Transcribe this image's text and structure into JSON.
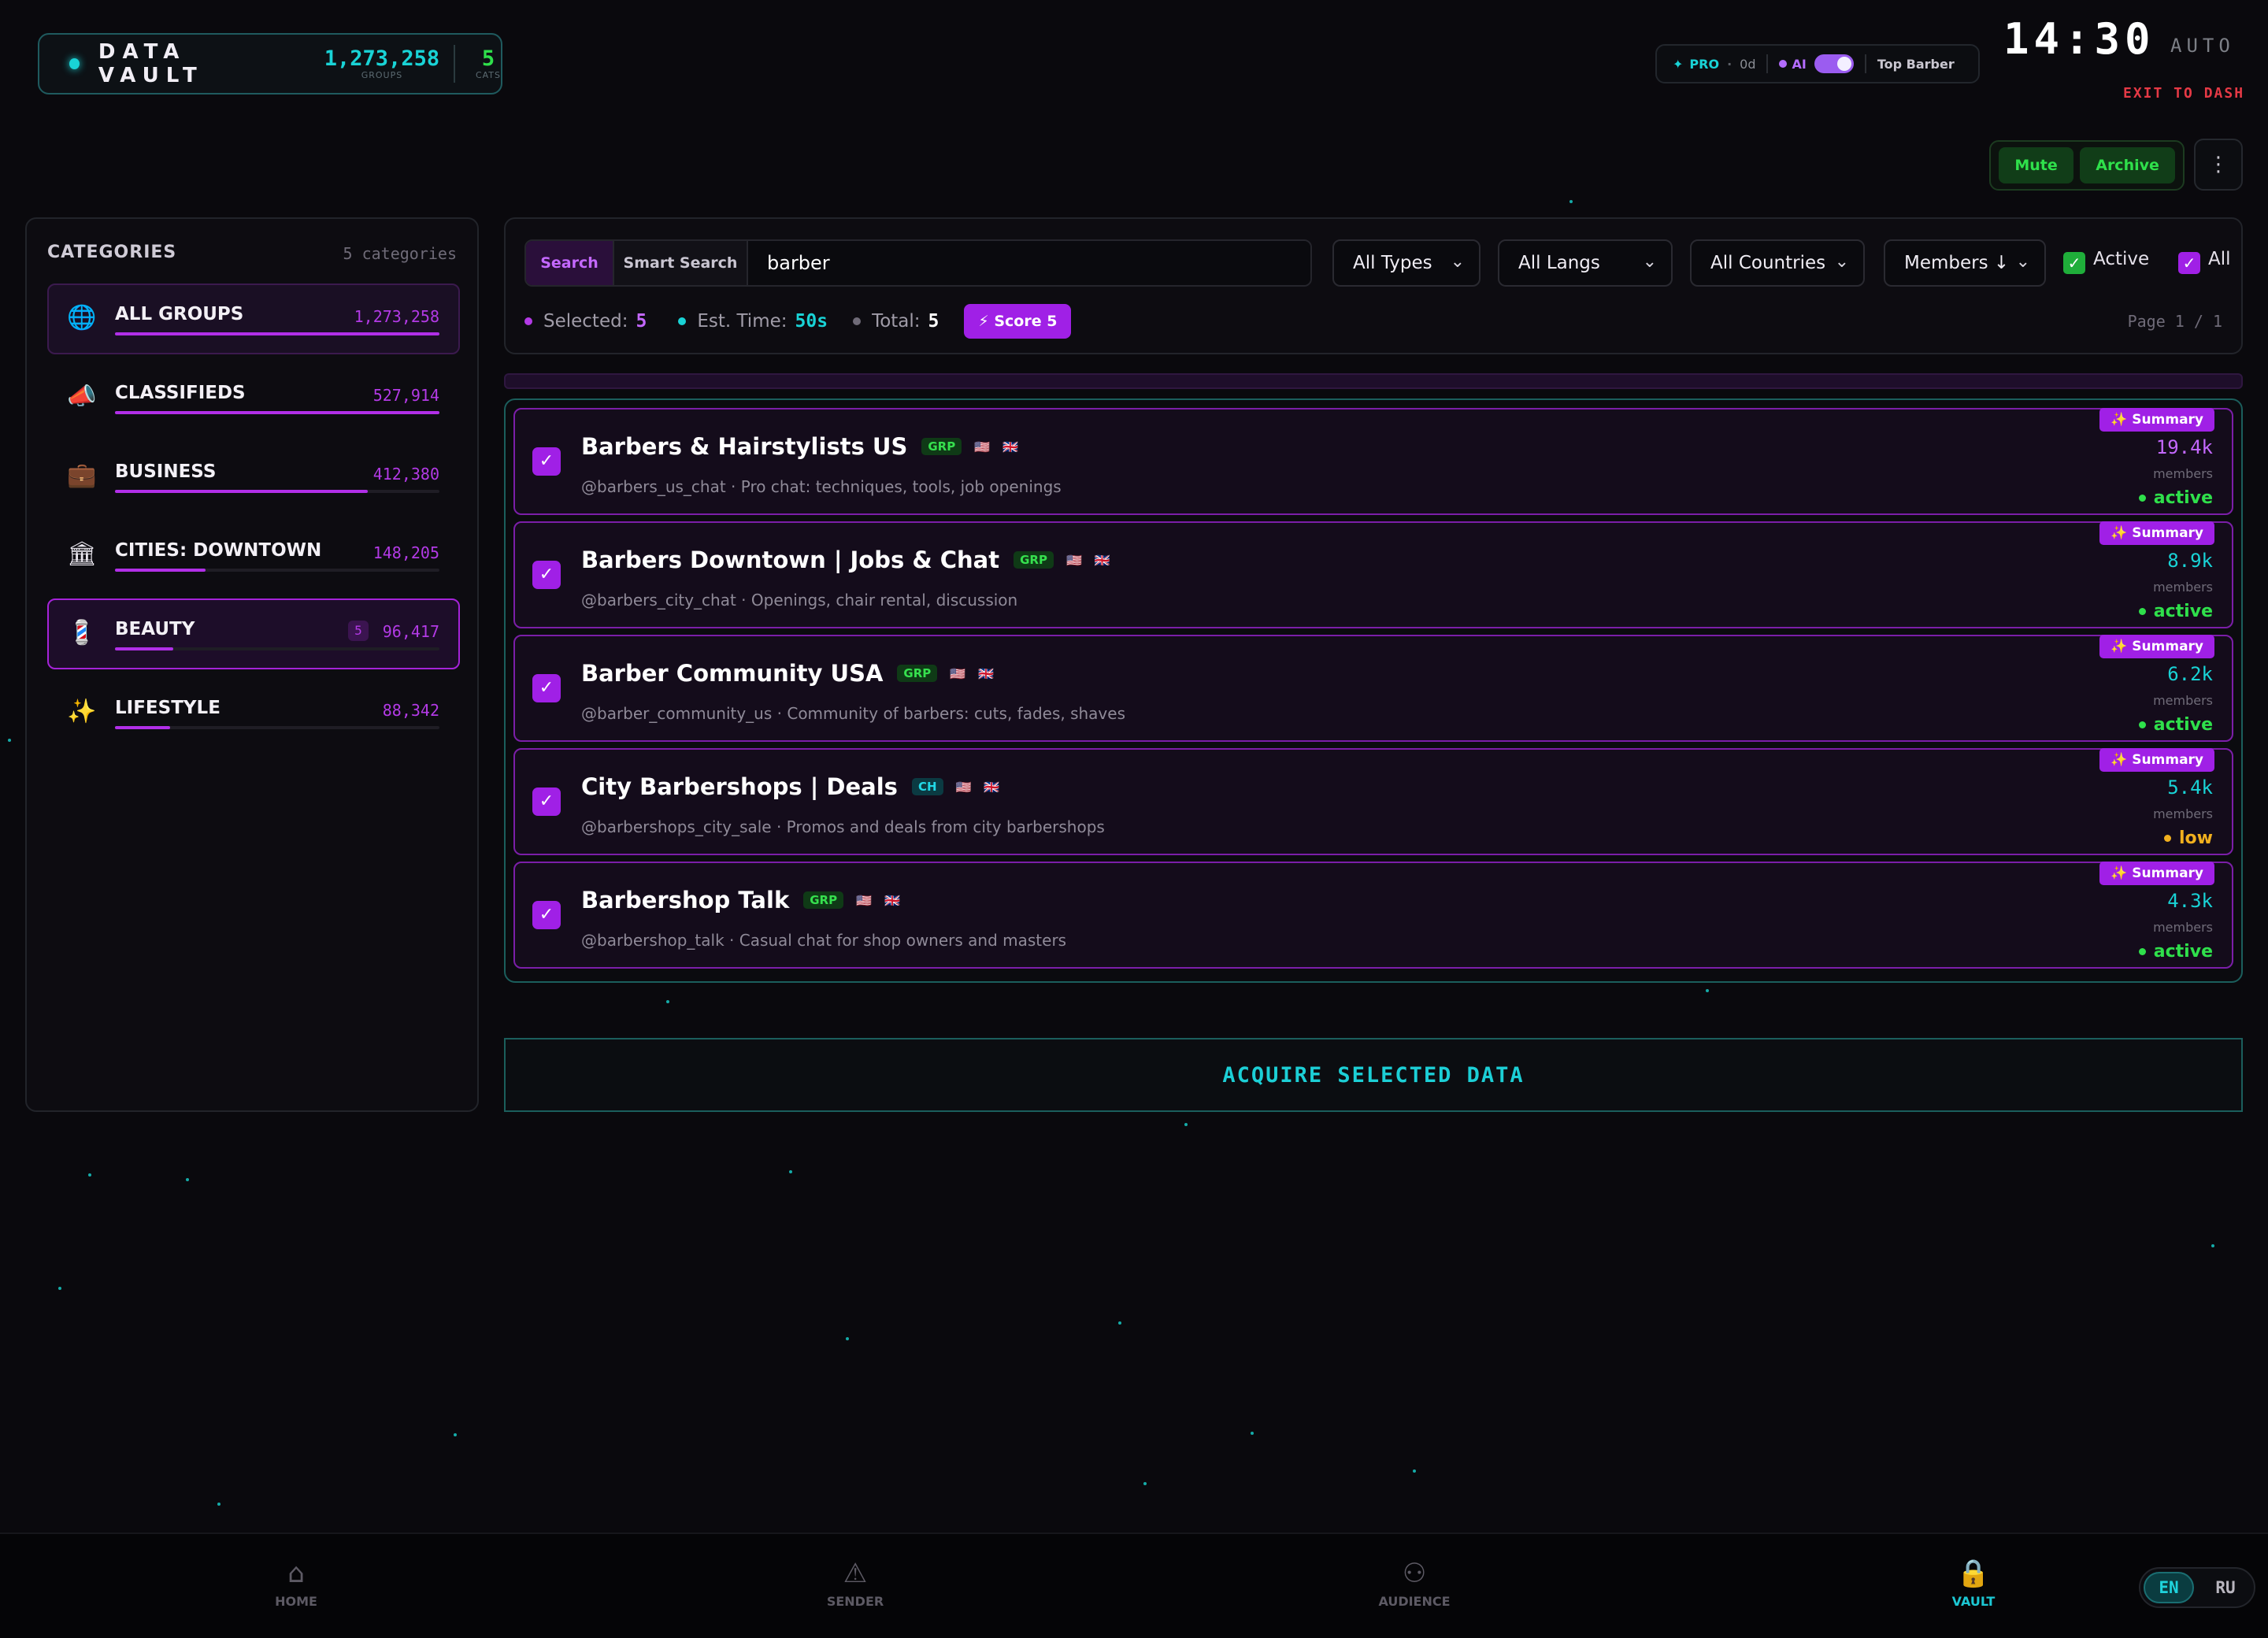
{
  "header": {
    "brand": "DATA VAULT",
    "groups_value": "1,273,258",
    "groups_label": "GROUPS",
    "cats_value": "5",
    "cats_label": "CATS",
    "plan": "PRO",
    "days": "0d",
    "ai_label": "AI",
    "profile": "Top Barber",
    "clock": "14:30",
    "mode": "AUTO",
    "exit_label": "EXIT TO DASH",
    "mute_label": "Mute",
    "archive_label": "Archive",
    "more_icon": "⋮"
  },
  "sidebar": {
    "title": "CATEGORIES",
    "count": "5 categories",
    "items": [
      {
        "icon": "globe-icon",
        "glyph": "🌐",
        "label": "ALL GROUPS",
        "count": "1,273,258",
        "fill": 1.0
      },
      {
        "icon": "megaphone-icon",
        "glyph": "📣",
        "label": "CLASSIFIEDS",
        "count": "527,914",
        "fill": 1.0
      },
      {
        "icon": "briefcase-icon",
        "glyph": "💼",
        "label": "BUSINESS",
        "count": "412,380",
        "fill": 0.78
      },
      {
        "icon": "bank-icon",
        "glyph": "🏛",
        "label": "CITIES: DOWNTOWN",
        "count": "148,205",
        "fill": 0.28
      },
      {
        "icon": "barber-pole-icon",
        "glyph": "💈",
        "label": "BEAUTY",
        "badge": "5",
        "count": "96,417",
        "fill": 0.18
      },
      {
        "icon": "sparkles-icon",
        "glyph": "✨",
        "label": "LIFESTYLE",
        "count": "88,342",
        "fill": 0.17
      }
    ]
  },
  "filters": {
    "tab_search": "Search",
    "tab_smart": "Smart Search",
    "query": "barber",
    "types": "All Types",
    "langs": "All Langs",
    "countries": "All Countries",
    "sort": "Members ↓",
    "active_label": "Active",
    "all_label": "All",
    "selected_label": "Selected:",
    "selected_value": "5",
    "est_label": "Est. Time:",
    "est_value": "50s",
    "total_label": "Total:",
    "total_value": "5",
    "score_label": "⚡ Score 5",
    "page": "Page 1 / 1"
  },
  "results": [
    {
      "name": "Barbers & Hairstylists US",
      "type": "GRP",
      "flags": [
        "🇺🇸",
        "🇬🇧"
      ],
      "desc": "@barbers_us_chat · Pro chat: techniques, tools, job openings",
      "members": "19.4k",
      "status": "active",
      "summary": "✨ Summary"
    },
    {
      "name": "Barbers Downtown | Jobs & Chat",
      "type": "GRP",
      "flags": [
        "🇺🇸",
        "🇬🇧"
      ],
      "desc": "@barbers_city_chat · Openings, chair rental, discussion",
      "members": "8.9k",
      "status": "active",
      "summary": "✨ Summary"
    },
    {
      "name": "Barber Community USA",
      "type": "GRP",
      "flags": [
        "🇺🇸",
        "🇬🇧"
      ],
      "desc": "@barber_community_us · Community of barbers: cuts, fades, shaves",
      "members": "6.2k",
      "status": "active",
      "summary": "✨ Summary"
    },
    {
      "name": "City Barbershops | Deals",
      "type": "CH",
      "flags": [
        "🇺🇸",
        "🇬🇧"
      ],
      "desc": "@barbershops_city_sale · Promos and deals from city barbershops",
      "members": "5.4k",
      "status": "low",
      "summary": "✨ Summary"
    },
    {
      "name": "Barbershop Talk",
      "type": "GRP",
      "flags": [
        "🇺🇸",
        "🇬🇧"
      ],
      "desc": "@barbershop_talk · Casual chat for shop owners and masters",
      "members": "4.3k",
      "status": "active",
      "summary": "✨ Summary"
    }
  ],
  "members_label": "members",
  "acquire_label": "ACQUIRE SELECTED DATA",
  "nav": [
    {
      "label": "HOME",
      "icon": "home-icon"
    },
    {
      "label": "SENDER",
      "icon": "send-icon"
    },
    {
      "label": "AUDIENCE",
      "icon": "audience-icon"
    },
    {
      "label": "VAULT",
      "icon": "lock-icon"
    }
  ],
  "lang": {
    "en": "EN",
    "ru": "RU"
  },
  "colors": {
    "accent": "#a020e6",
    "cyan": "#1ccfd6",
    "green": "#2fe04b",
    "warn": "#f2b01e"
  }
}
